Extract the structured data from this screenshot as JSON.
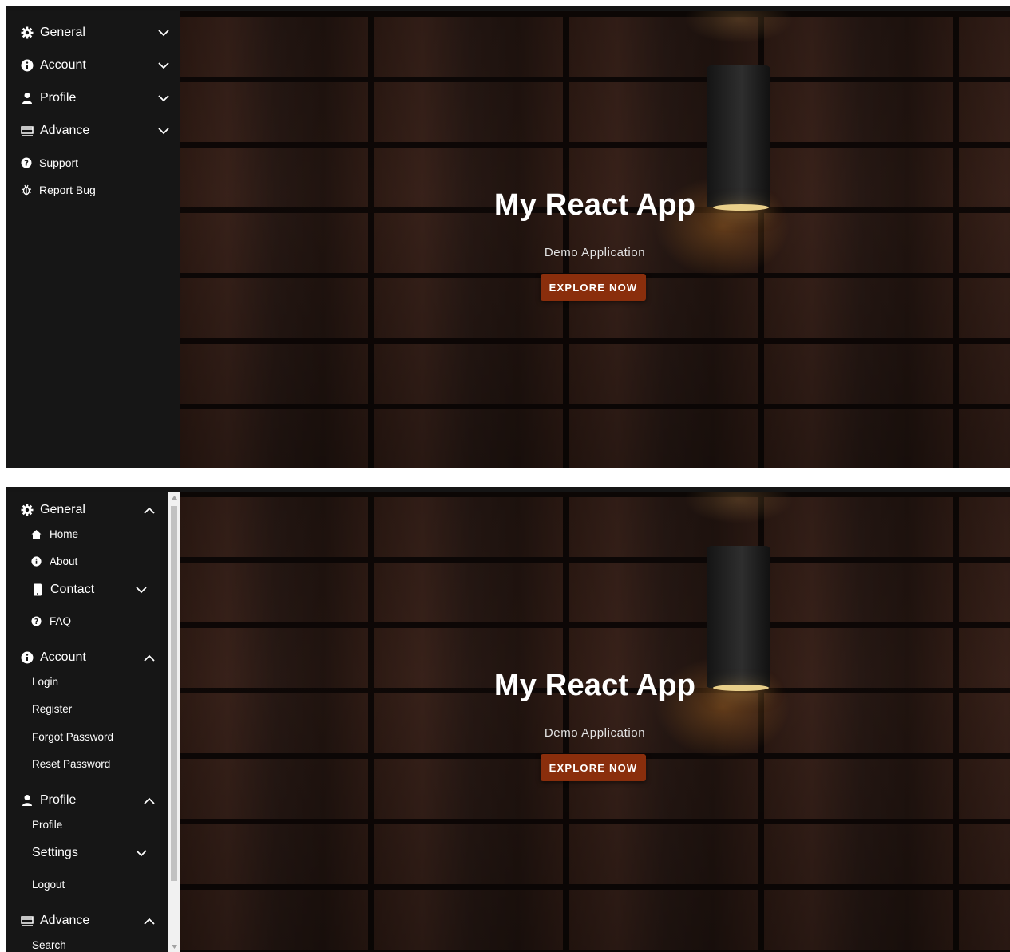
{
  "shot1": {
    "sidebar": {
      "items": [
        {
          "label": "General",
          "icon": "gear-icon"
        },
        {
          "label": "Account",
          "icon": "info-icon"
        },
        {
          "label": "Profile",
          "icon": "person-icon"
        },
        {
          "label": "Advance",
          "icon": "advance-icon"
        },
        {
          "label": "Support",
          "icon": "question-icon"
        },
        {
          "label": "Report Bug",
          "icon": "bug-icon"
        }
      ]
    },
    "hero": {
      "title": "My React App",
      "subtitle": "Demo Application",
      "button_label": "EXPLORE NOW"
    }
  },
  "shot2": {
    "sidebar": {
      "general": {
        "label": "General",
        "children": [
          {
            "label": "Home",
            "icon": "home-icon"
          },
          {
            "label": "About",
            "icon": "info-icon"
          },
          {
            "label": "Contact",
            "icon": "phone-icon"
          },
          {
            "label": "FAQ",
            "icon": "question-icon"
          }
        ]
      },
      "account": {
        "label": "Account",
        "children": [
          {
            "label": "Login"
          },
          {
            "label": "Register"
          },
          {
            "label": "Forgot Password"
          },
          {
            "label": "Reset Password"
          }
        ]
      },
      "profile": {
        "label": "Profile",
        "children": [
          {
            "label": "Profile"
          },
          {
            "label": "Settings"
          },
          {
            "label": "Logout"
          }
        ]
      },
      "advance": {
        "label": "Advance",
        "children": [
          {
            "label": "Search"
          }
        ]
      }
    },
    "hero": {
      "title": "My React App",
      "subtitle": "Demo Application",
      "button_label": "EXPLORE NOW"
    }
  },
  "colors": {
    "sidebar_bg": "#161616",
    "button_bg": "#8a2e0c",
    "text": "#ffffff"
  }
}
